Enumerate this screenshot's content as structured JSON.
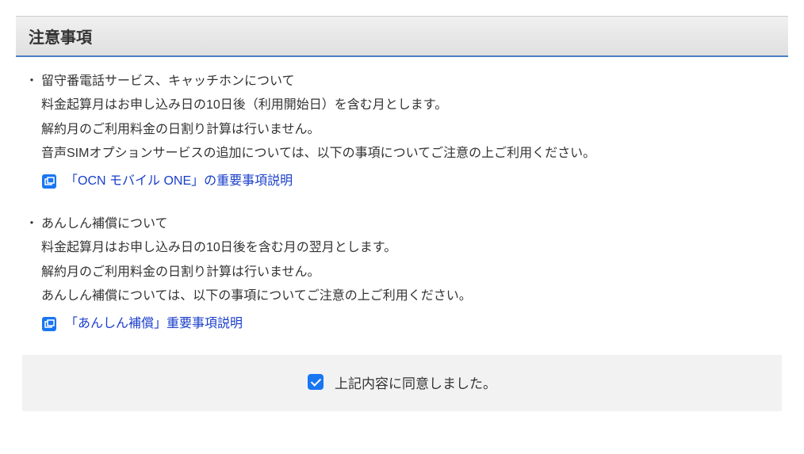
{
  "header": {
    "title": "注意事項"
  },
  "notices": [
    {
      "title": "留守番電話サービス、キャッチホンについて",
      "lines": [
        "料金起算月はお申し込み日の10日後（利用開始日）を含む月とします。",
        "解約月のご利用料金の日割り計算は行いません。",
        "音声SIMオプションサービスの追加については、以下の事項についてご注意の上ご利用ください。"
      ],
      "link_label": "「OCN モバイル ONE」の重要事項説明"
    },
    {
      "title": "あんしん補償について",
      "lines": [
        "料金起算月はお申し込み日の10日後を含む月の翌月とします。",
        "解約月のご利用料金の日割り計算は行いません。",
        "あんしん補償については、以下の事項についてご注意の上ご利用ください。"
      ],
      "link_label": "「あんしん補償」重要事項説明"
    }
  ],
  "agree": {
    "label": "上記内容に同意しました。",
    "checked": true
  }
}
